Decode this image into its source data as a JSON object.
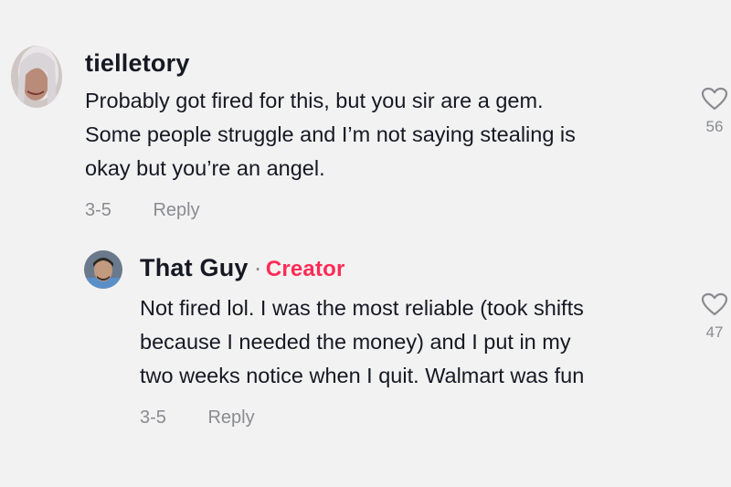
{
  "comments": [
    {
      "username": "tielletory",
      "text": "Probably got fired for this, but you sir are a gem.\nSome people struggle and I’m not saying stealing is\nokay but you’re an angel.",
      "date": "3-5",
      "reply_label": "Reply",
      "like_count": "56",
      "avatar_icon": "user-avatar"
    },
    {
      "username": "That Guy",
      "separator": "·",
      "badge": "Creator",
      "text": "Not fired lol. I was the most reliable (took shifts\nbecause I needed the money) and I put in my\ntwo weeks notice when I quit. Walmart was fun",
      "date": "3-5",
      "reply_label": "Reply",
      "like_count": "47",
      "avatar_icon": "user-avatar"
    }
  ],
  "colors": {
    "background": "#f2f2f2",
    "text": "#161823",
    "muted": "#8a8b91",
    "creator_badge": "#fe2c55"
  },
  "icons": {
    "like": "heart-outline-icon"
  }
}
